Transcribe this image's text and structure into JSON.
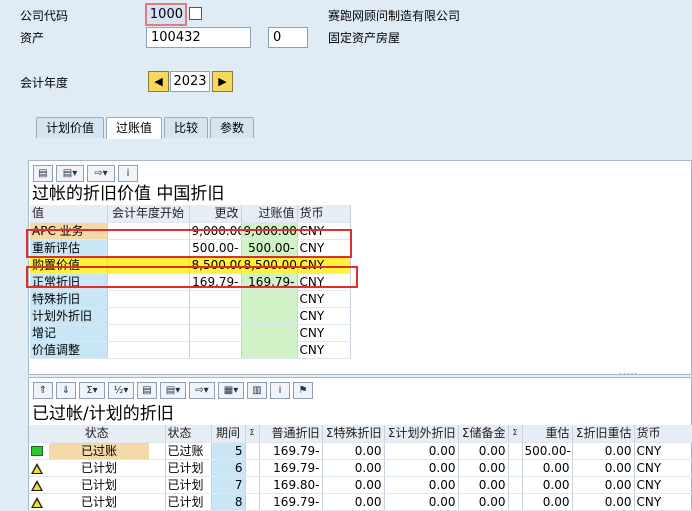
{
  "header": {
    "company_code_label": "公司代码",
    "company_code_value": "1000",
    "company_name": "赛跑网顾问制造有限公司",
    "asset_label": "资产",
    "asset_value": "100432",
    "sub_asset_value": "0",
    "asset_description": "固定资产房屋",
    "fiscal_year_label": "会计年度",
    "fiscal_year_value": "2023",
    "prev_icon": "arrow-left-icon",
    "next_icon": "arrow-right-icon"
  },
  "tabs": [
    {
      "label": "计划价值"
    },
    {
      "label": "过账值"
    },
    {
      "label": "比较"
    },
    {
      "label": "参数"
    }
  ],
  "values_panel": {
    "title": "过帐的折旧价值 中国折旧",
    "columns": [
      "值",
      "会计年度开始",
      "更改",
      "过账值",
      "货币"
    ],
    "rows": [
      {
        "name": "APC 业务",
        "start": "",
        "change": "9,000.00",
        "posted": "9,000.00",
        "currency": "CNY"
      },
      {
        "name": "重新评估",
        "start": "",
        "change": "500.00-",
        "posted": "500.00-",
        "currency": "CNY"
      },
      {
        "name": "购置价值",
        "start": "",
        "change": "8,500.00",
        "posted": "8,500.00",
        "currency": "CNY"
      },
      {
        "name": "正常折旧",
        "start": "",
        "change": "169.79-",
        "posted": "169.79-",
        "currency": "CNY"
      },
      {
        "name": "特殊折旧",
        "start": "",
        "change": "",
        "posted": "",
        "currency": "CNY"
      },
      {
        "name": "计划外折旧",
        "start": "",
        "change": "",
        "posted": "",
        "currency": "CNY"
      },
      {
        "name": "增记",
        "start": "",
        "change": "",
        "posted": "",
        "currency": "CNY"
      },
      {
        "name": "价值调整",
        "start": "",
        "change": "",
        "posted": "",
        "currency": "CNY"
      }
    ]
  },
  "depr_panel": {
    "title": "已过帐/计划的折旧",
    "columns": [
      "状态",
      "状态",
      "期间",
      "Σ",
      "普通折旧",
      "Σ特殊折旧",
      "Σ计划外折旧",
      "Σ储备金",
      "Σ",
      "重估",
      "Σ折旧重估",
      "货币"
    ],
    "rows": [
      {
        "icon": "green-square-icon",
        "status1": "已过账",
        "status2": "已过账",
        "period": "5",
        "normal": "169.79-",
        "special": "0.00",
        "unplanned": "0.00",
        "reserve": "0.00",
        "reval": "500.00-",
        "depr_reval": "0.00",
        "currency": "CNY"
      },
      {
        "icon": "warning-triangle-icon",
        "status1": "已计划",
        "status2": "已计划",
        "period": "6",
        "normal": "169.79-",
        "special": "0.00",
        "unplanned": "0.00",
        "reserve": "0.00",
        "reval": "0.00",
        "depr_reval": "0.00",
        "currency": "CNY"
      },
      {
        "icon": "warning-triangle-icon",
        "status1": "已计划",
        "status2": "已计划",
        "period": "7",
        "normal": "169.80-",
        "special": "0.00",
        "unplanned": "0.00",
        "reserve": "0.00",
        "reval": "0.00",
        "depr_reval": "0.00",
        "currency": "CNY"
      },
      {
        "icon": "warning-triangle-icon",
        "status1": "已计划",
        "status2": "已计划",
        "period": "8",
        "normal": "169.79-",
        "special": "0.00",
        "unplanned": "0.00",
        "reserve": "0.00",
        "reval": "0.00",
        "depr_reval": "0.00",
        "currency": "CNY"
      }
    ]
  },
  "colors": {
    "highlight_yellow": "#fff23a",
    "annotation_red": "#e02d2d",
    "posted_green": "#cff2c6"
  }
}
